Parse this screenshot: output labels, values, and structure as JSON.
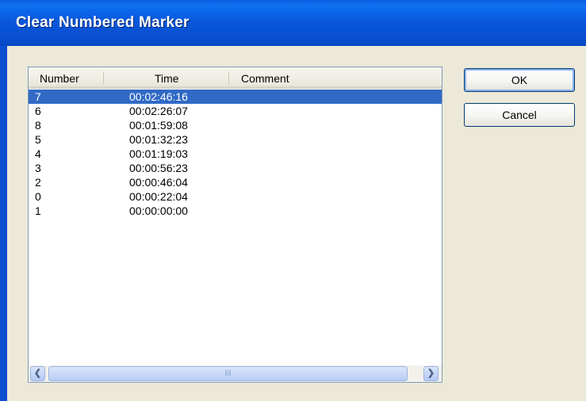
{
  "window": {
    "title": "Clear Numbered Marker"
  },
  "list": {
    "columns": [
      "Number",
      "Time",
      "Comment"
    ],
    "rows": [
      {
        "number": "7",
        "time": "00:02:46:16",
        "comment": ""
      },
      {
        "number": "6",
        "time": "00:02:26:07",
        "comment": ""
      },
      {
        "number": "8",
        "time": "00:01:59:08",
        "comment": ""
      },
      {
        "number": "5",
        "time": "00:01:32:23",
        "comment": ""
      },
      {
        "number": "4",
        "time": "00:01:19:03",
        "comment": ""
      },
      {
        "number": "3",
        "time": "00:00:56:23",
        "comment": ""
      },
      {
        "number": "2",
        "time": "00:00:46:04",
        "comment": ""
      },
      {
        "number": "0",
        "time": "00:00:22:04",
        "comment": ""
      },
      {
        "number": "1",
        "time": "00:00:00:00",
        "comment": ""
      }
    ],
    "selected_index": 0
  },
  "buttons": {
    "ok_label": "OK",
    "cancel_label": "Cancel"
  },
  "colors": {
    "titlebar": "#0a58dc",
    "selection": "#316ac5",
    "dialog_bg": "#ece9d8"
  },
  "icons": {
    "scroll_left": "scroll-left-arrow-icon",
    "scroll_right": "scroll-right-arrow-icon"
  }
}
